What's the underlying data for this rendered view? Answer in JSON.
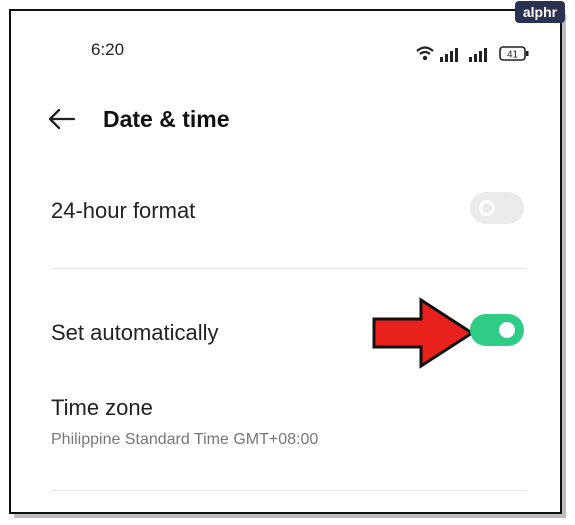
{
  "watermark": {
    "text": "alphr"
  },
  "status_bar": {
    "time": "6:20",
    "battery": "41",
    "icons": [
      "wifi-icon",
      "signal-icon",
      "signal-icon",
      "battery-icon"
    ]
  },
  "header": {
    "title": "Date & time",
    "back_icon": "back-arrow-icon"
  },
  "settings": [
    {
      "label": "24-hour format",
      "type": "toggle",
      "enabled": false
    },
    {
      "label": "Set automatically",
      "type": "toggle",
      "enabled": true
    },
    {
      "label": "Time zone",
      "value": "Philippine Standard Time GMT+08:00"
    }
  ],
  "annotation": {
    "icon": "red-arrow-icon",
    "color": "#e8211c"
  },
  "colors": {
    "toggle_on": "#2ecc87",
    "toggle_off": "#ebebeb"
  }
}
